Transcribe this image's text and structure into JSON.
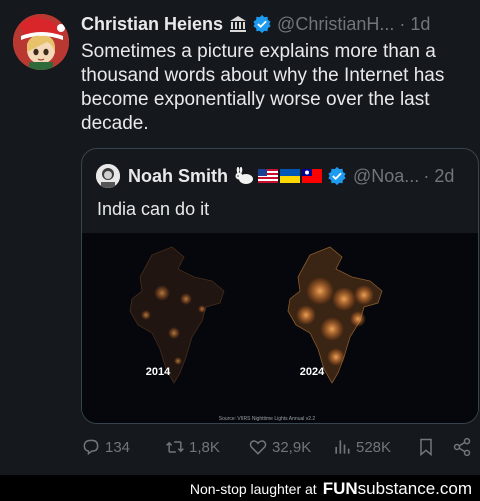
{
  "tweet": {
    "author": {
      "name": "Christian Heiens",
      "handle": "@ChristianH...",
      "time": "1d",
      "separator": "·",
      "avatar_icon": "santa-hat-anime-avatar",
      "badges": [
        "bank-building-icon",
        "verified-badge-icon"
      ]
    },
    "text_lines": [
      "Sometimes a picture explains more than a",
      "thousand words about why the Internet has",
      "become exponentially worse over the last",
      "decade."
    ],
    "quote": {
      "name": "Noah Smith",
      "handle": "@Noa...",
      "time": "2d",
      "separator": "·",
      "emojis": [
        "rabbit",
        "us-flag",
        "ukraine-flag",
        "taiwan-flag"
      ],
      "text": "India can do it",
      "image": {
        "label_left": "2014",
        "label_right": "2024",
        "source": "Source: VIIRS Nighttime Lights Annual v2.2"
      }
    },
    "actions": {
      "replies": "134",
      "reposts": "1,8K",
      "likes": "32,9K",
      "views": "528K"
    }
  },
  "footer": {
    "tagline": "Non-stop laughter at",
    "brand_fun": "FUN",
    "brand_sub": "substance",
    "brand_com": ".com"
  },
  "colors": {
    "background": "#15181c",
    "text": "#e7e9ea",
    "muted": "#71767b",
    "verified": "#1d9bf0",
    "border": "#38444d"
  }
}
